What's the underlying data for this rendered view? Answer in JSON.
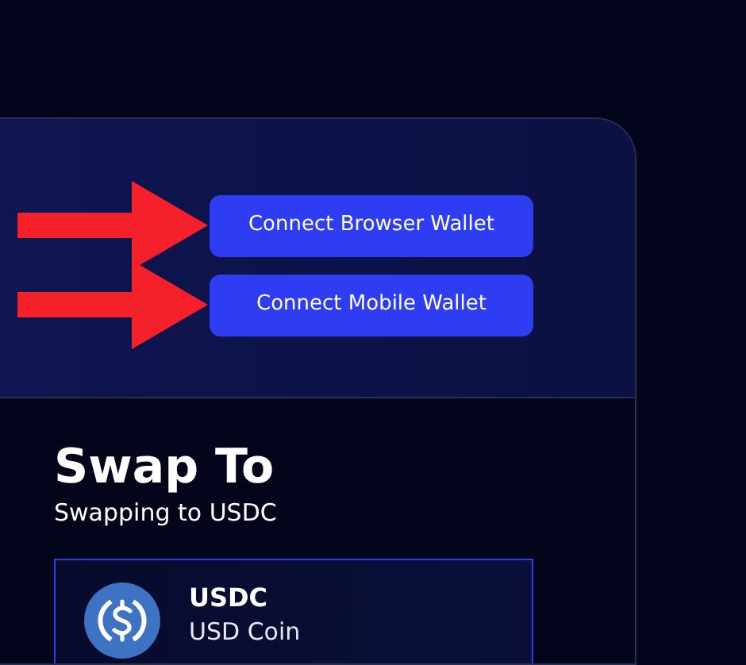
{
  "wallet_buttons": [
    {
      "label": "Connect Browser Wallet"
    },
    {
      "label": "Connect Mobile Wallet"
    }
  ],
  "swap": {
    "title": "Swap To",
    "subtitle": "Swapping to USDC",
    "token": {
      "symbol": "USDC",
      "name": "USD Coin"
    }
  }
}
